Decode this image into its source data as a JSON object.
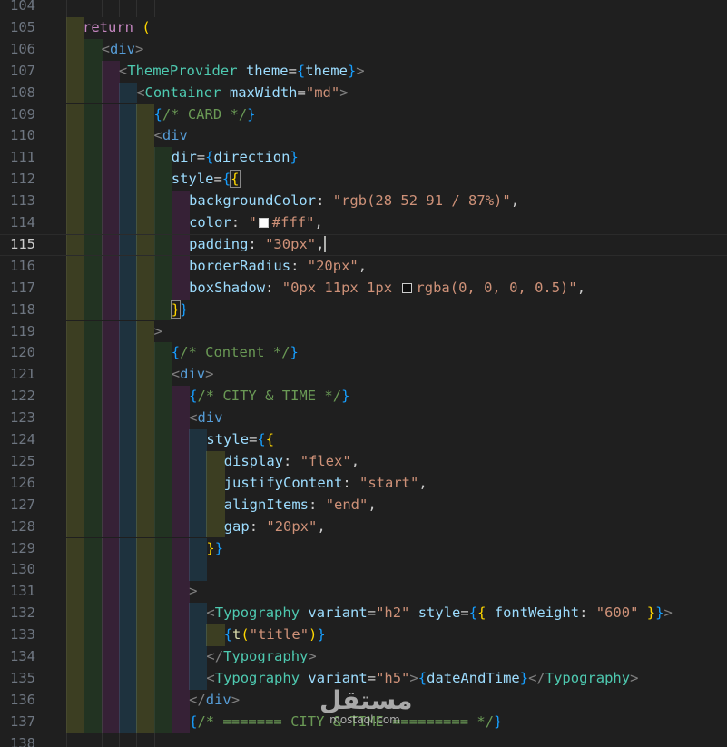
{
  "editor": {
    "theme": "dark",
    "current_line": 115,
    "colors": {
      "background": "#1f1f1f",
      "line_number": "#6e7681",
      "line_number_active": "#cccccc",
      "keyword": "#c586c0",
      "tag": "#4ec9b0",
      "bracket_tag": "#808080",
      "attribute": "#9cdcfe",
      "string": "#ce9178",
      "comment": "#6a9955",
      "brace_gold": "#ffd700",
      "brace_orchid": "#da70d6",
      "brace_blue": "#179fff",
      "text": "#cccccc"
    },
    "lines": [
      {
        "num": "104",
        "tokens": []
      },
      {
        "num": "105",
        "tokens": [
          {
            "t": "return",
            "c": "keyword"
          },
          {
            "t": " (",
            "c": "brace_gold"
          }
        ]
      },
      {
        "num": "106",
        "tokens": [
          {
            "t": "<",
            "c": "bracket_tag"
          },
          {
            "t": "div",
            "c": "blue_tag"
          },
          {
            "t": ">",
            "c": "bracket_tag"
          }
        ]
      },
      {
        "num": "107",
        "tokens": [
          {
            "t": "<",
            "c": "bracket_tag"
          },
          {
            "t": "ThemeProvider",
            "c": "tag"
          },
          {
            "t": " theme",
            "c": "attribute"
          },
          {
            "t": "=",
            "c": "text"
          },
          {
            "t": "{",
            "c": "brace_blue"
          },
          {
            "t": "theme",
            "c": "attribute"
          },
          {
            "t": "}",
            "c": "brace_blue"
          },
          {
            "t": ">",
            "c": "bracket_tag"
          }
        ]
      },
      {
        "num": "108",
        "tokens": [
          {
            "t": "<",
            "c": "bracket_tag"
          },
          {
            "t": "Container",
            "c": "tag"
          },
          {
            "t": " maxWidth",
            "c": "attribute"
          },
          {
            "t": "=",
            "c": "text"
          },
          {
            "t": "\"md\"",
            "c": "string"
          },
          {
            "t": ">",
            "c": "bracket_tag"
          }
        ]
      },
      {
        "num": "109",
        "tokens": [
          {
            "t": "{",
            "c": "brace_blue"
          },
          {
            "t": "/* CARD */",
            "c": "comment"
          },
          {
            "t": "}",
            "c": "brace_blue"
          }
        ]
      },
      {
        "num": "110",
        "tokens": [
          {
            "t": "<",
            "c": "bracket_tag"
          },
          {
            "t": "div",
            "c": "blue_tag"
          }
        ]
      },
      {
        "num": "111",
        "tokens": [
          {
            "t": "dir",
            "c": "attribute"
          },
          {
            "t": "=",
            "c": "text"
          },
          {
            "t": "{",
            "c": "brace_blue"
          },
          {
            "t": "direction",
            "c": "attribute"
          },
          {
            "t": "}",
            "c": "brace_blue"
          }
        ]
      },
      {
        "num": "112",
        "tokens": [
          {
            "t": "style",
            "c": "attribute"
          },
          {
            "t": "=",
            "c": "text"
          },
          {
            "t": "{",
            "c": "brace_blue"
          },
          {
            "t": "{",
            "c": "brace_gold_match"
          }
        ]
      },
      {
        "num": "113",
        "tokens": [
          {
            "t": "backgroundColor",
            "c": "attribute"
          },
          {
            "t": ": ",
            "c": "text"
          },
          {
            "t": "\"rgb(28 52 91 / 87%)\"",
            "c": "string"
          },
          {
            "t": ",",
            "c": "text"
          }
        ]
      },
      {
        "num": "114",
        "tokens": [
          {
            "t": "color",
            "c": "attribute"
          },
          {
            "t": ": ",
            "c": "text"
          },
          {
            "t": "\"",
            "c": "string"
          },
          {
            "swatch": "#ffffff"
          },
          {
            "t": "#fff\"",
            "c": "string"
          },
          {
            "t": ",",
            "c": "text"
          }
        ]
      },
      {
        "num": "115",
        "tokens": [
          {
            "t": "padding",
            "c": "attribute"
          },
          {
            "t": ": ",
            "c": "text"
          },
          {
            "t": "\"30px\"",
            "c": "string"
          },
          {
            "t": ",",
            "c": "text"
          },
          {
            "cursor": true
          }
        ]
      },
      {
        "num": "116",
        "tokens": [
          {
            "t": "borderRadius",
            "c": "attribute"
          },
          {
            "t": ": ",
            "c": "text"
          },
          {
            "t": "\"20px\"",
            "c": "string"
          },
          {
            "t": ",",
            "c": "text"
          }
        ]
      },
      {
        "num": "117",
        "tokens": [
          {
            "t": "boxShadow",
            "c": "attribute"
          },
          {
            "t": ": ",
            "c": "text"
          },
          {
            "t": "\"0px 11px 1px ",
            "c": "string"
          },
          {
            "swatch": "rgba(0,0,0,0.5)"
          },
          {
            "t": "rgba(0, 0, 0, 0.5)\"",
            "c": "string"
          },
          {
            "t": ",",
            "c": "text"
          }
        ]
      },
      {
        "num": "118",
        "tokens": [
          {
            "t": "}",
            "c": "brace_gold_match"
          },
          {
            "t": "}",
            "c": "brace_blue"
          }
        ]
      },
      {
        "num": "119",
        "tokens": [
          {
            "t": ">",
            "c": "bracket_tag"
          }
        ]
      },
      {
        "num": "120",
        "tokens": [
          {
            "t": "{",
            "c": "brace_blue"
          },
          {
            "t": "/* Content */",
            "c": "comment"
          },
          {
            "t": "}",
            "c": "brace_blue"
          }
        ]
      },
      {
        "num": "121",
        "tokens": [
          {
            "t": "<",
            "c": "bracket_tag"
          },
          {
            "t": "div",
            "c": "blue_tag"
          },
          {
            "t": ">",
            "c": "bracket_tag"
          }
        ]
      },
      {
        "num": "122",
        "tokens": [
          {
            "t": "{",
            "c": "brace_blue"
          },
          {
            "t": "/* CITY & TIME */",
            "c": "comment"
          },
          {
            "t": "}",
            "c": "brace_blue"
          }
        ]
      },
      {
        "num": "123",
        "tokens": [
          {
            "t": "<",
            "c": "bracket_tag"
          },
          {
            "t": "div",
            "c": "blue_tag"
          }
        ]
      },
      {
        "num": "124",
        "tokens": [
          {
            "t": "style",
            "c": "attribute"
          },
          {
            "t": "=",
            "c": "text"
          },
          {
            "t": "{",
            "c": "brace_blue"
          },
          {
            "t": "{",
            "c": "brace_gold"
          }
        ]
      },
      {
        "num": "125",
        "tokens": [
          {
            "t": "display",
            "c": "attribute"
          },
          {
            "t": ": ",
            "c": "text"
          },
          {
            "t": "\"flex\"",
            "c": "string"
          },
          {
            "t": ",",
            "c": "text"
          }
        ]
      },
      {
        "num": "126",
        "tokens": [
          {
            "t": "justifyContent",
            "c": "attribute"
          },
          {
            "t": ": ",
            "c": "text"
          },
          {
            "t": "\"start\"",
            "c": "string"
          },
          {
            "t": ",",
            "c": "text"
          }
        ]
      },
      {
        "num": "127",
        "tokens": [
          {
            "t": "alignItems",
            "c": "attribute"
          },
          {
            "t": ": ",
            "c": "text"
          },
          {
            "t": "\"end\"",
            "c": "string"
          },
          {
            "t": ",",
            "c": "text"
          }
        ]
      },
      {
        "num": "128",
        "tokens": [
          {
            "t": "gap",
            "c": "attribute"
          },
          {
            "t": ": ",
            "c": "text"
          },
          {
            "t": "\"20px\"",
            "c": "string"
          },
          {
            "t": ",",
            "c": "text"
          }
        ]
      },
      {
        "num": "129",
        "tokens": [
          {
            "t": "}",
            "c": "brace_gold"
          },
          {
            "t": "}",
            "c": "brace_blue"
          }
        ]
      },
      {
        "num": "130",
        "tokens": []
      },
      {
        "num": "131",
        "tokens": [
          {
            "t": ">",
            "c": "bracket_tag"
          }
        ]
      },
      {
        "num": "132",
        "tokens": [
          {
            "t": "<",
            "c": "bracket_tag"
          },
          {
            "t": "Typography",
            "c": "tag"
          },
          {
            "t": " variant",
            "c": "attribute"
          },
          {
            "t": "=",
            "c": "text"
          },
          {
            "t": "\"h2\"",
            "c": "string"
          },
          {
            "t": " style",
            "c": "attribute"
          },
          {
            "t": "=",
            "c": "text"
          },
          {
            "t": "{",
            "c": "brace_blue"
          },
          {
            "t": "{",
            "c": "brace_gold"
          },
          {
            "t": " fontWeight",
            "c": "attribute"
          },
          {
            "t": ": ",
            "c": "text"
          },
          {
            "t": "\"600\"",
            "c": "string"
          },
          {
            "t": " ",
            "c": "text"
          },
          {
            "t": "}",
            "c": "brace_gold"
          },
          {
            "t": "}",
            "c": "brace_blue"
          },
          {
            "t": ">",
            "c": "bracket_tag"
          }
        ]
      },
      {
        "num": "133",
        "tokens": [
          {
            "t": "{",
            "c": "brace_blue"
          },
          {
            "t": "t",
            "c": "function"
          },
          {
            "t": "(",
            "c": "brace_gold"
          },
          {
            "t": "\"title\"",
            "c": "string"
          },
          {
            "t": ")",
            "c": "brace_gold"
          },
          {
            "t": "}",
            "c": "brace_blue"
          }
        ]
      },
      {
        "num": "134",
        "tokens": [
          {
            "t": "</",
            "c": "bracket_tag"
          },
          {
            "t": "Typography",
            "c": "tag"
          },
          {
            "t": ">",
            "c": "bracket_tag"
          }
        ]
      },
      {
        "num": "135",
        "tokens": [
          {
            "t": "<",
            "c": "bracket_tag"
          },
          {
            "t": "Typography",
            "c": "tag"
          },
          {
            "t": " variant",
            "c": "attribute"
          },
          {
            "t": "=",
            "c": "text"
          },
          {
            "t": "\"h5\"",
            "c": "string"
          },
          {
            "t": ">",
            "c": "bracket_tag"
          },
          {
            "t": "{",
            "c": "brace_blue"
          },
          {
            "t": "dateAndTime",
            "c": "attribute"
          },
          {
            "t": "}",
            "c": "brace_blue"
          },
          {
            "t": "</",
            "c": "bracket_tag"
          },
          {
            "t": "Typography",
            "c": "tag"
          },
          {
            "t": ">",
            "c": "bracket_tag"
          }
        ]
      },
      {
        "num": "136",
        "tokens": [
          {
            "t": "</",
            "c": "bracket_tag"
          },
          {
            "t": "div",
            "c": "blue_tag"
          },
          {
            "t": ">",
            "c": "bracket_tag"
          }
        ]
      },
      {
        "num": "137",
        "tokens": [
          {
            "t": "{",
            "c": "brace_blue"
          },
          {
            "t": "/* ======= CITY & TIME ========= */",
            "c": "comment"
          },
          {
            "t": "}",
            "c": "brace_blue"
          }
        ]
      },
      {
        "num": "138",
        "tokens": []
      }
    ]
  },
  "watermark": {
    "arabic": "مستقل",
    "latin": "mostaql.com"
  }
}
